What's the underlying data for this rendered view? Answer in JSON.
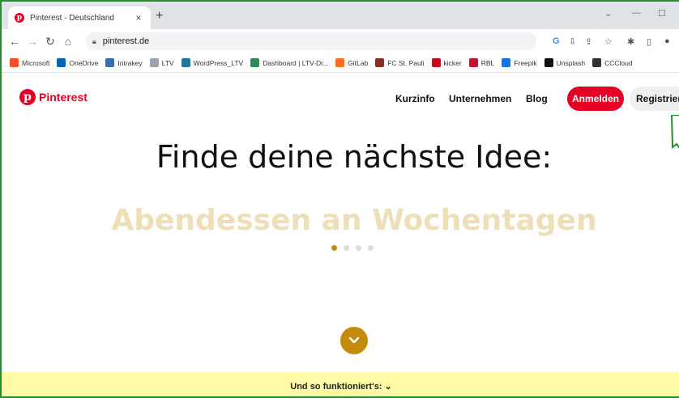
{
  "browser": {
    "tab_title": "Pinterest - Deutschland",
    "tab_close": "×",
    "new_tab": "+",
    "url": "pinterest.de",
    "window_controls": [
      "⌄",
      "—",
      "☐"
    ]
  },
  "bookmarks": [
    {
      "label": "Microsoft",
      "icon": "microsoft-icon",
      "color": "#f25022"
    },
    {
      "label": "OneDrive",
      "icon": "onedrive-icon",
      "color": "#0364b8"
    },
    {
      "label": "Intrakey",
      "icon": "globe-icon",
      "color": "#3b6ea5"
    },
    {
      "label": "LTV",
      "icon": "ltv-icon",
      "color": "#9aa5b1"
    },
    {
      "label": "WordPress_LTV",
      "icon": "wordpress-icon",
      "color": "#21759b"
    },
    {
      "label": "Dashboard | LTV-Di...",
      "icon": "dashboard-icon",
      "color": "#2e8b57"
    },
    {
      "label": "GitLab",
      "icon": "gitlab-icon",
      "color": "#fc6d26"
    },
    {
      "label": "FC St. Pauli",
      "icon": "stpauli-icon",
      "color": "#8b2c22"
    },
    {
      "label": "kicker",
      "icon": "kicker-icon",
      "color": "#d0021b"
    },
    {
      "label": "RBL",
      "icon": "rbl-icon",
      "color": "#c8102e"
    },
    {
      "label": "Freepik",
      "icon": "freepik-icon",
      "color": "#1273eb"
    },
    {
      "label": "Unsplash",
      "icon": "unsplash-icon",
      "color": "#111111"
    },
    {
      "label": "CCCloud",
      "icon": "cccloud-icon",
      "color": "#333333"
    }
  ],
  "site": {
    "logo_text": "Pinterest",
    "nav": {
      "kurzinfo": "Kurzinfo",
      "unternehmen": "Unternehmen",
      "blog": "Blog"
    },
    "login_label": "Anmelden",
    "register_label": "Registriere"
  },
  "hero": {
    "headline": "Finde deine nächste Idee:",
    "rotating_text": "Abendessen an Wochentagen"
  },
  "footer": {
    "how_it_works": "Und so funktioniert's: ⌄"
  },
  "colors": {
    "brand_red": "#e60023",
    "accent_gold": "#c28b0b",
    "subtitle_beige": "#efdfb8",
    "footer_yellow": "#fffaa6"
  }
}
